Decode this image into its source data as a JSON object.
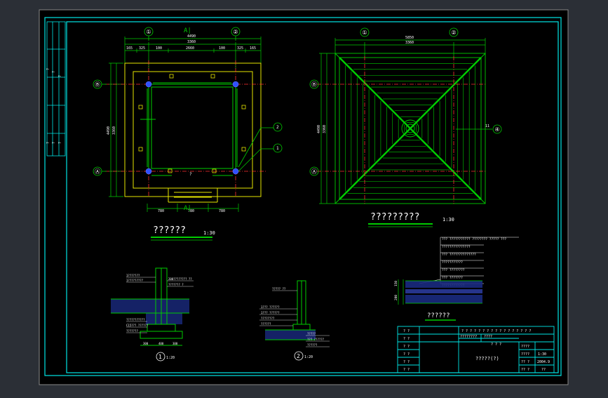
{
  "colors": {
    "background": "#2b2f36",
    "paper": "#000000",
    "frame": "#00e6e6",
    "dim": "#00cc00",
    "wall": "#e6e600",
    "axis": "#ff3030",
    "text": "#ffffff",
    "column": "#3050ff",
    "hatch": "#3060ff"
  },
  "axis_labels": {
    "one": "①",
    "two": "②",
    "a": "Ⓐ",
    "b": "Ⓑ",
    "section_top": "A|",
    "section_bottom": "A|"
  },
  "plan_left": {
    "title": "??????",
    "scale": "1:30",
    "dims_top_overall": "4490",
    "dims_top_mid": "3360",
    "dims_top_row": [
      "165",
      "325",
      "100",
      "2660",
      "100",
      "325",
      "165"
    ],
    "dims_left_overall": "4490",
    "dims_left_mid": "3360",
    "dims_bottom_row": [
      "780",
      "780",
      "780"
    ],
    "callouts": [
      "2",
      "1"
    ],
    "stair_mark": "?"
  },
  "plan_right": {
    "title": "?????????",
    "scale": "1:30",
    "dims_top_overall": "5850",
    "dims_top_mid": "3360",
    "dims_left_overall": "4490",
    "dims_left_mid": "3360",
    "callout": "11",
    "callout_axis": "④"
  },
  "detail_1": {
    "label": "1",
    "scale": "1:20",
    "notes": [
      "1???????",
      "1?????????",
      "200???????? ??",
      "??????? ?",
      "???????????",
      "C15??? ??????",
      "???????"
    ],
    "dims_bottom": [
      "300",
      "400",
      "300"
    ]
  },
  "detail_2": {
    "label": "2",
    "scale": "1:20",
    "notes": [
      "????? ??",
      "1??? ??????",
      "1??? ??????",
      "????????",
      "??????",
      "?????",
      "??? ??????",
      "??????"
    ]
  },
  "legend": {
    "title": "??????",
    "header": "??? ???????????  ????????  ????? ???",
    "rows": [
      "???????????????",
      "??? ??????????????",
      "???????????",
      "??? ????????",
      "??? ???????",
      "????????????"
    ],
    "side_dims": [
      "150",
      "200"
    ]
  },
  "title_block": {
    "project": "? ? ? ? ? ? ? ? ? ? ? ? ? ? ? ? ?",
    "sub_1": "????????",
    "sub_2": "????",
    "sub_3": "? ? ?",
    "drawing": "?????(?)",
    "left_cells": [
      "? ?",
      "? ?",
      "? ?",
      "? ?",
      "? ?",
      "? ?"
    ],
    "right_cells": [
      "????",
      "????",
      "?? ?",
      "?? ?"
    ],
    "scale": "1:30",
    "date": "2004.9",
    "sheet": "??"
  },
  "rev_strip": {
    "cells": [
      "?",
      "?",
      "?",
      "?",
      "?",
      "?",
      "?",
      "?",
      "?",
      "?"
    ]
  }
}
